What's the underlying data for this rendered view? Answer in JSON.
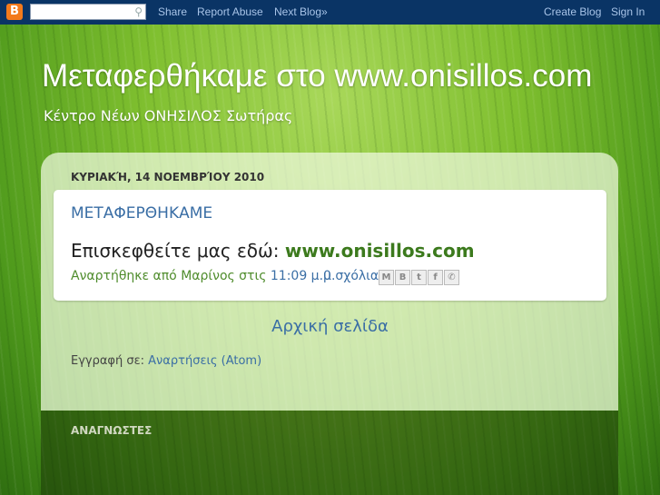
{
  "navbar": {
    "logo_letter": "B",
    "search_placeholder": "",
    "share": "Share",
    "report_abuse": "Report Abuse",
    "next_blog": "Next Blog»",
    "create_blog": "Create Blog",
    "sign_in": "Sign In"
  },
  "header": {
    "title": "Μεταφερθήκαμε στο www.onisillos.com",
    "description": "Κέντρο Νέων ΟΝΗΣΙΛΟΣ Σωτήρας"
  },
  "post": {
    "date": "ΚΥΡΙΑΚΉ, 14 ΝΟΕΜΒΡΊΟΥ 2010",
    "title": "ΜΕΤΑΦΕΡΘΗΚΑΜΕ",
    "body_text": "Επισκεφθείτε μας εδώ: ",
    "body_link": "www.onisillos.com",
    "byline_prefix": "Αναρτήθηκε από Μαρίνος στις ",
    "time": "11:09 μ.μ.",
    "comments": "0 σχόλια",
    "share_icons": [
      "email-icon",
      "blogger-icon",
      "twitter-icon",
      "facebook-icon",
      "buzz-icon"
    ],
    "share_glyphs": [
      "M",
      "B",
      "t",
      "f",
      "✆"
    ]
  },
  "footer": {
    "home_link": "Αρχική σελίδα",
    "subscribe_label": "Εγγραφή σε: ",
    "subscribe_link": "Αναρτήσεις (Atom)"
  },
  "sidebar": {
    "readers_title": "ΑΝΑΓΝΩΣΤΕΣ"
  },
  "colors": {
    "navbar": "#0a3465",
    "link": "#3a6ea5",
    "accent_green": "#3c7a1d"
  }
}
